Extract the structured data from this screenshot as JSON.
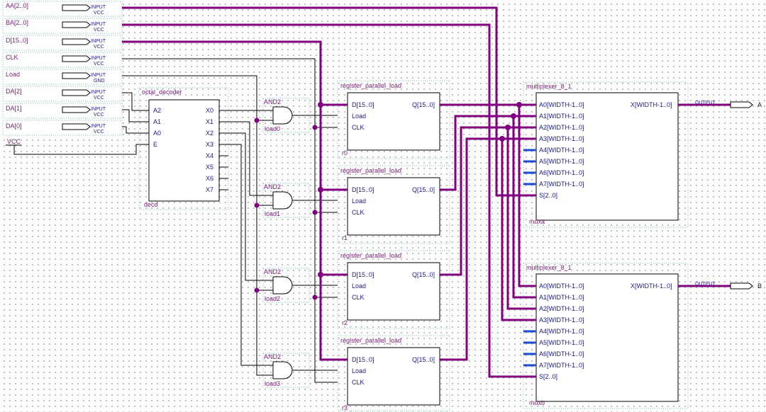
{
  "input_pins": [
    {
      "name": "AA[2..0]",
      "dir": "INPUT",
      "default": "VCC"
    },
    {
      "name": "BA[2..0]",
      "dir": "INPUT",
      "default": "VCC"
    },
    {
      "name": "D[15..0]",
      "dir": "INPUT",
      "default": "VCC"
    },
    {
      "name": "CLK",
      "dir": "INPUT",
      "default": "VCC"
    },
    {
      "name": "Load",
      "dir": "INPUT",
      "default": "GND"
    },
    {
      "name": "DA[2]",
      "dir": "INPUT",
      "default": "VCC"
    },
    {
      "name": "DA[1]",
      "dir": "INPUT",
      "default": "VCC"
    },
    {
      "name": "DA[0]",
      "dir": "INPUT",
      "default": "VCC"
    }
  ],
  "vcc_label": "VCC",
  "decoder": {
    "type": "octal_decoder",
    "instance": "decd",
    "inputs": [
      "A2",
      "A1",
      "A0",
      "E"
    ],
    "outputs": [
      "X0",
      "X1",
      "X2",
      "X3",
      "X4",
      "X5",
      "X6",
      "X7"
    ]
  },
  "and_gates": [
    {
      "type": "AND2",
      "instance": "load0"
    },
    {
      "type": "AND2",
      "instance": "load1"
    },
    {
      "type": "AND2",
      "instance": "load2"
    },
    {
      "type": "AND2",
      "instance": "load3"
    }
  ],
  "registers": [
    {
      "type": "register_parallel_load",
      "instance": "r0"
    },
    {
      "type": "register_parallel_load",
      "instance": "r1"
    },
    {
      "type": "register_parallel_load",
      "instance": "r2"
    },
    {
      "type": "register_parallel_load",
      "instance": "r3"
    }
  ],
  "register_ports": {
    "d": "D[15..0]",
    "load": "Load",
    "clk": "CLK",
    "q": "Q[15..0]"
  },
  "muxes": [
    {
      "type": "multiplexer_8_1",
      "instance": "muxa"
    },
    {
      "type": "multiplexer_8_1",
      "instance": "muxb"
    }
  ],
  "mux_inputs": [
    "A0[WIDTH-1..0]",
    "A1[WIDTH-1..0]",
    "A2[WIDTH-1..0]",
    "A3[WIDTH-1..0]",
    "A4[WIDTH-1..0]",
    "A5[WIDTH-1..0]",
    "A6[WIDTH-1..0]",
    "A7[WIDTH-1..0]",
    "S[2..0]"
  ],
  "mux_output": "X[WIDTH-1..0]",
  "output_pins": [
    {
      "name": "A",
      "dir": "OUTPUT"
    },
    {
      "name": "B",
      "dir": "OUTPUT"
    }
  ],
  "colors": {
    "bus": "#800080",
    "wire": "#000000",
    "pin_label": "#1a1a9c",
    "instance_label": "#7a1a7a"
  }
}
